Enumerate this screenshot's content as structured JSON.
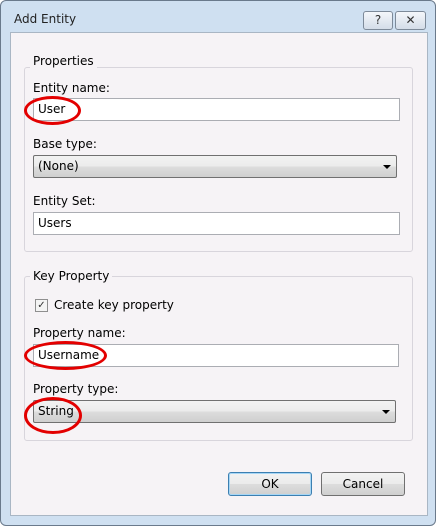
{
  "window": {
    "title": "Add Entity",
    "help_label": "?",
    "close_label": "✕"
  },
  "properties": {
    "legend": "Properties",
    "entity_name_label": "Entity name:",
    "entity_name_value": "User",
    "base_type_label": "Base type:",
    "base_type_value": "(None)",
    "entity_set_label": "Entity Set:",
    "entity_set_value": "Users"
  },
  "key_property": {
    "legend": "Key Property",
    "create_key_label": "Create key property",
    "create_key_checked": "✓",
    "property_name_label": "Property name:",
    "property_name_value": "Username",
    "property_type_label": "Property type:",
    "property_type_value": "String"
  },
  "buttons": {
    "ok": "OK",
    "cancel": "Cancel"
  },
  "colors": {
    "annotation": "#e30000"
  }
}
